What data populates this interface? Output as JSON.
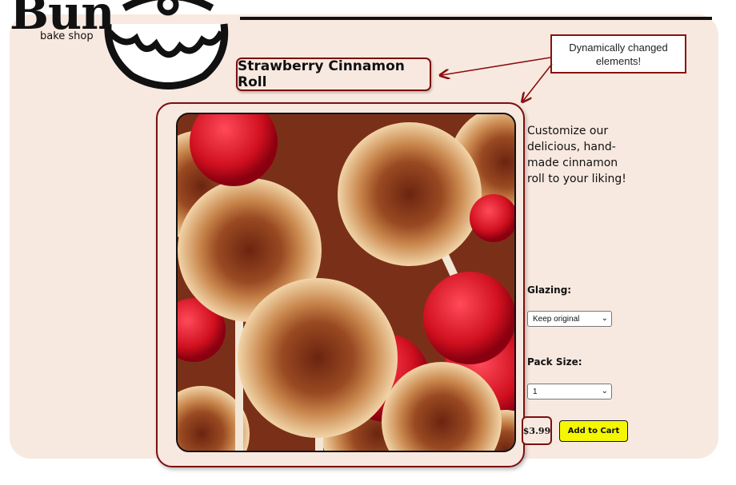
{
  "brand": {
    "logo_text": "Bun",
    "subtitle": "bake shop"
  },
  "product": {
    "title": "Strawberry Cinnamon Roll",
    "description": "Customize our delicious, hand-made cinnamon roll to your liking!",
    "price": "$3.99"
  },
  "annotation": {
    "text": "Dynamically changed elements!"
  },
  "options": {
    "glazing_label": "Glazing:",
    "glazing_value": "Keep original",
    "pack_label": "Pack Size:",
    "pack_value": "1"
  },
  "actions": {
    "add_to_cart": "Add to Cart"
  },
  "colors": {
    "accent_border": "#7b0f10",
    "page_background": "#f8e9e0",
    "button_fill": "#f4f700"
  }
}
